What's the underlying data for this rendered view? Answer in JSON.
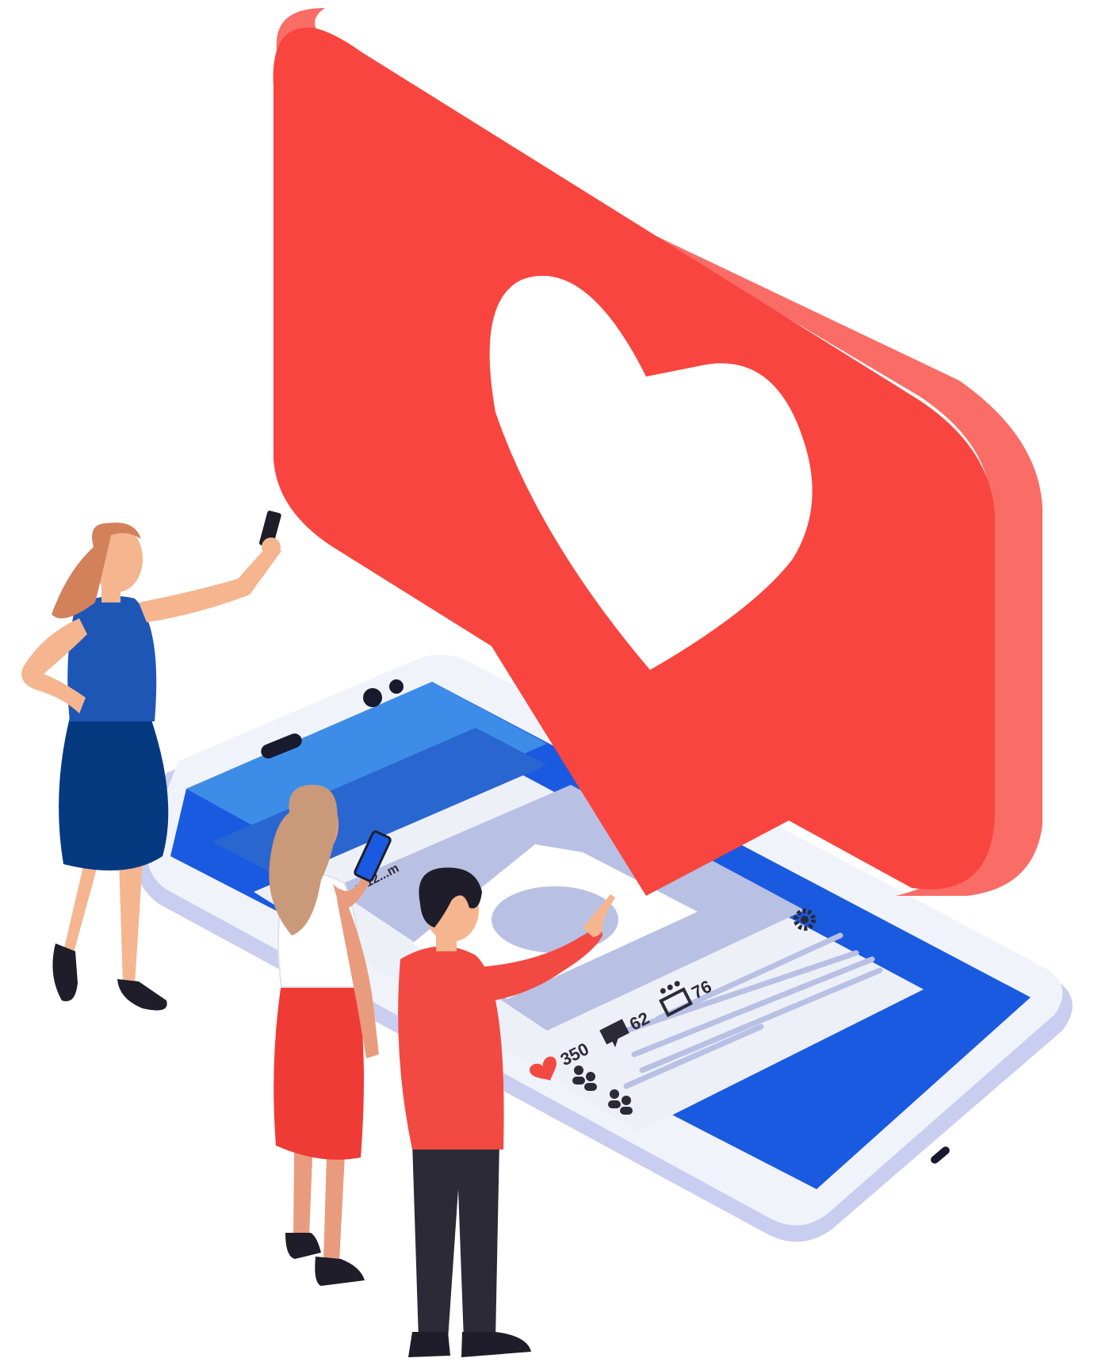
{
  "post": {
    "likes": "350",
    "comments": "62",
    "shares": "76",
    "partial_date": "y 12...m"
  },
  "icons": {
    "badge": "heart-icon",
    "likes": "heart-icon",
    "comments": "speech-bubble-icon",
    "shares": "share-icon",
    "settings": "gear-icon"
  },
  "colors": {
    "notification_red": "#f9453f",
    "notification_side": "#fa6c66",
    "phone_blue": "#1a5ae0",
    "header_blue": "#3d8de8",
    "card_white": "#eef0f8",
    "placeholder_lavender": "#b8c0e4",
    "woman_blue_dress": "#1e56b5",
    "woman_blue_skirt": "#063a80",
    "red_skirt": "#ef3b35",
    "man_red_shirt": "#f24a42",
    "dark_pants": "#2b2a36"
  }
}
